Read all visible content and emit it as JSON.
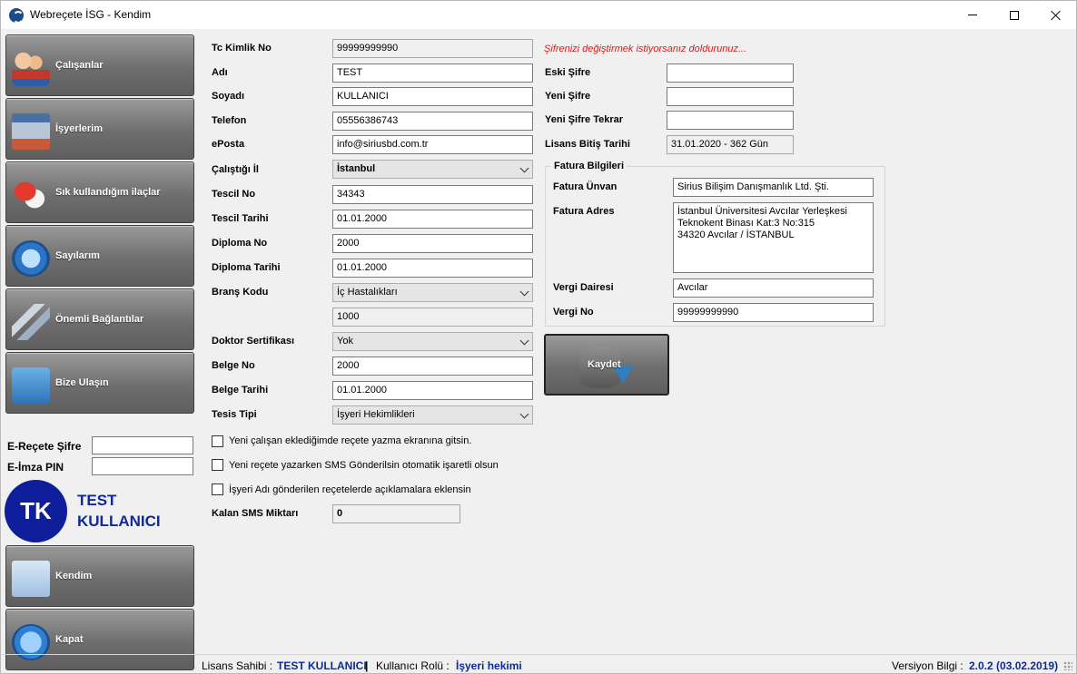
{
  "window": {
    "title": "Webreçete İSG - Kendim"
  },
  "sidebar": {
    "items": [
      {
        "label": "Çalışanlar",
        "icon": "users-icon"
      },
      {
        "label": "İşyerlerim",
        "icon": "building-icon"
      },
      {
        "label": "Sık kullandığım ilaçlar",
        "icon": "pill-icon"
      },
      {
        "label": "Sayılarım",
        "icon": "gauge-icon"
      },
      {
        "label": "Önemli Bağlantılar",
        "icon": "chain-link-icon"
      },
      {
        "label": "Bize Ulaşın",
        "icon": "envelope-icon"
      }
    ],
    "ereçete_label": "E-Reçete Şifre",
    "eimza_label": "E-İmza PIN",
    "avatar_initials": "TK",
    "user_first": "TEST",
    "user_last": "KULLANICI",
    "kendim_label": "Kendim",
    "kapat_label": "Kapat"
  },
  "form": {
    "tc": {
      "label": "Tc Kimlik No",
      "value": "99999999990"
    },
    "adi": {
      "label": "Adı",
      "value": "TEST"
    },
    "soyadi": {
      "label": "Soyadı",
      "value": "KULLANICI"
    },
    "telefon": {
      "label": "Telefon",
      "value": "05556386743"
    },
    "eposta": {
      "label": "ePosta",
      "value": "info@siriusbd.com.tr"
    },
    "il": {
      "label": "Çalıştığı İl",
      "value": "İstanbul"
    },
    "tescil_no": {
      "label": "Tescil No",
      "value": "34343"
    },
    "tescil_tarihi": {
      "label": "Tescil Tarihi",
      "value": "01.01.2000"
    },
    "diploma_no": {
      "label": "Diploma No",
      "value": "2000"
    },
    "diploma_tarihi": {
      "label": "Diploma Tarihi",
      "value": "01.01.2000"
    },
    "brans": {
      "label": "Branş Kodu",
      "value": "İç Hastalıkları",
      "code": "1000"
    },
    "sertifika": {
      "label": "Doktor Sertifikası",
      "value": "Yok"
    },
    "belge_no": {
      "label": "Belge No",
      "value": "2000"
    },
    "belge_tarihi": {
      "label": "Belge Tarihi",
      "value": "01.01.2000"
    },
    "tesis": {
      "label": "Tesis Tipi",
      "value": "İşyeri Hekimlikleri"
    },
    "checks": [
      "Yeni çalışan eklediğimde reçete yazma ekranına gitsin.",
      "Yeni reçete yazarken SMS Gönderilsin otomatik işaretli olsun",
      "İşyeri Adı gönderilen reçetelerde açıklamalara eklensin"
    ],
    "sms": {
      "label": "Kalan SMS Miktarı",
      "value": "0"
    }
  },
  "password": {
    "hint": "Şifrenizi değiştirmek istiyorsanız doldurunuz...",
    "eski": "Eski Şifre",
    "yeni": "Yeni Şifre",
    "tekrar": "Yeni Şifre Tekrar",
    "lisans_label": "Lisans Bitiş Tarihi",
    "lisans_value": "31.01.2020 - 362 Gün"
  },
  "invoice": {
    "title": "Fatura Bilgileri",
    "unvan_label": "Fatura Ünvan",
    "unvan_value": "Sirius Bilişim Danışmanlık Ltd. Şti.",
    "adres_label": "Fatura Adres",
    "adres_lines": [
      "İstanbul Üniversitesi Avcılar Yerleşkesi",
      "Teknokent Binası Kat:3 No:315",
      "34320 Avcılar / İSTANBUL"
    ],
    "vergi_dairesi_label": "Vergi Dairesi",
    "vergi_dairesi_value": "Avcılar",
    "vergi_no_label": "Vergi No",
    "vergi_no_value": "99999999990"
  },
  "save_label": "Kaydet",
  "status": {
    "owner_label": "Lisans Sahibi :",
    "owner_value": "TEST KULLANICI",
    "sep": "|",
    "role_label": "Kullanıcı Rolü :",
    "role_value": "İşyeri hekimi",
    "version_label": "Versiyon Bilgi :",
    "version_value": "2.0.2 (03.02.2019)"
  }
}
